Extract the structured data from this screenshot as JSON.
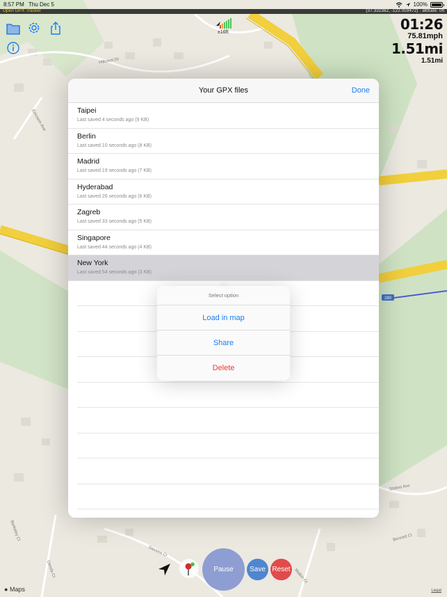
{
  "status_bar": {
    "time": "8:57 PM",
    "date": "Thu Dec 5",
    "battery": "100%"
  },
  "app_strip": {
    "title": "Open GPX Tracker",
    "coordinates": "(37.332382, -122.059472) · altitude: 0ft"
  },
  "signal": {
    "accuracy": "±16ft"
  },
  "stats": {
    "timer": "01:26",
    "speed": "75.81mph",
    "total_distance": "1.51mi",
    "segment_distance": "1.51mi"
  },
  "modal": {
    "title": "Your GPX files",
    "done_label": "Done",
    "files": [
      {
        "name": "Taipei",
        "subtitle": "Last saved 4 seconds ago (9 KB)"
      },
      {
        "name": "Berlin",
        "subtitle": "Last saved 10 seconds ago (8 KB)"
      },
      {
        "name": "Madrid",
        "subtitle": "Last saved 19 seconds ago (7 KB)"
      },
      {
        "name": "Hyderabad",
        "subtitle": "Last saved 26 seconds ago (6 KB)"
      },
      {
        "name": "Zagreb",
        "subtitle": "Last saved 33 seconds ago (5 KB)"
      },
      {
        "name": "Singapore",
        "subtitle": "Last saved 44 seconds ago (4 KB)"
      },
      {
        "name": "New York",
        "subtitle": "Last saved 54 seconds ago (3 KB)"
      }
    ],
    "selected_index": 6
  },
  "popover": {
    "title": "Select option",
    "items": [
      {
        "label": "Load in map",
        "style": "default"
      },
      {
        "label": "Share",
        "style": "default"
      },
      {
        "label": "Delete",
        "style": "destructive"
      }
    ]
  },
  "controls": {
    "pause_label": "Pause",
    "save_label": "Save",
    "reset_label": "Reset"
  },
  "map": {
    "attribution": "Maps",
    "legal": "Legal",
    "highway_shield": "280",
    "streets": [
      "Hillcrest Dr",
      "Stevens Cr",
      "Ericsson Ave",
      "Stokes Ave",
      "Bennett Ct",
      "Berkeley Ct",
      "Orinda Ct",
      "Malkin Ct"
    ]
  },
  "colors": {
    "accent": "#1a7df0",
    "destructive": "#ea3a36",
    "pause": "#8e9ed2",
    "save": "#4f86cf",
    "reset": "#e14b4b",
    "highway": "#f2cf3c",
    "park": "#cfe3c4"
  }
}
